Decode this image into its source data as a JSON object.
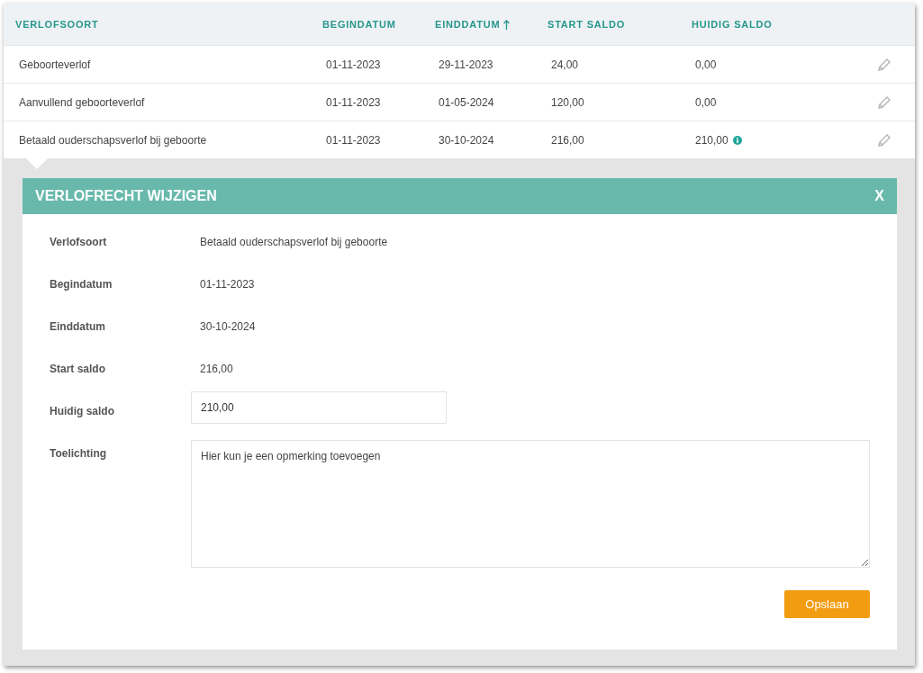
{
  "table": {
    "columns": [
      {
        "label": "VERLOFSOORT",
        "sorted": false
      },
      {
        "label": "BEGINDATUM",
        "sorted": false
      },
      {
        "label": "EINDDATUM",
        "sorted": true
      },
      {
        "label": "START SALDO",
        "sorted": false
      },
      {
        "label": "HUIDIG SALDO",
        "sorted": false
      }
    ],
    "rows": [
      {
        "cells": [
          "Geboorteverlof",
          "01-11-2023",
          "29-11-2023",
          "24,00",
          "0,00"
        ],
        "info": false
      },
      {
        "cells": [
          "Aanvullend geboorteverlof",
          "01-11-2023",
          "01-05-2024",
          "120,00",
          "0,00"
        ],
        "info": false
      },
      {
        "cells": [
          "Betaald ouderschapsverlof bij geboorte",
          "01-11-2023",
          "30-10-2024",
          "216,00",
          "210,00"
        ],
        "info": true
      }
    ]
  },
  "dialog": {
    "title": "VERLOFRECHT WIJZIGEN",
    "close": "X",
    "fields": [
      {
        "kind": "text",
        "label": "Verlofsoort",
        "value": "Betaald ouderschapsverlof bij geboorte"
      },
      {
        "kind": "text",
        "label": "Begindatum",
        "value": "01-11-2023"
      },
      {
        "kind": "text",
        "label": "Einddatum",
        "value": "30-10-2024"
      },
      {
        "kind": "text",
        "label": "Start saldo",
        "value": "216,00"
      },
      {
        "kind": "input",
        "label": "Huidig saldo",
        "value": "210,00"
      },
      {
        "kind": "textarea",
        "label": "Toelichting",
        "placeholder": "Hier kun je een opmerking toevoegen"
      }
    ],
    "save": "Opslaan"
  }
}
